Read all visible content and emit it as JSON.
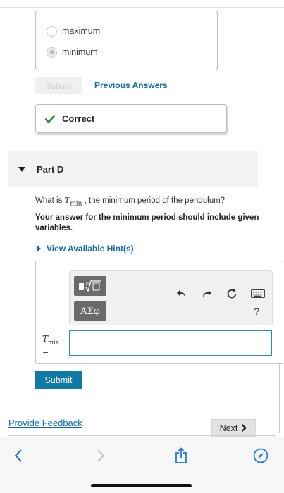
{
  "options": [
    {
      "label": "maximum",
      "selected": false
    },
    {
      "label": "minimum",
      "selected": true
    }
  ],
  "prev_part": {
    "submit_label": "Submit",
    "previous_answers_label": "Previous Answers",
    "feedback_label": "Correct"
  },
  "part": {
    "title": "Part D",
    "question_prefix": "What is ",
    "question_var": "T",
    "question_var_sub": "min",
    "question_suffix": " , the minimum period of the pendulum?",
    "instruction": "Your answer for the minimum period should include given variables.",
    "hints_label": "View Available Hint(s)"
  },
  "answer": {
    "greek_label": "ΑΣφ",
    "help_label": "?",
    "var_label": "T",
    "var_sub": "min",
    "equals": "=",
    "value": "",
    "submit_label": "Submit"
  },
  "footer": {
    "feedback_link": "Provide Feedback",
    "next_label": "Next"
  },
  "colors": {
    "link": "#0b6db1",
    "submit": "#0e7aa5",
    "correct_check": "#2e8b2e",
    "input_focus": "#1f8fd6",
    "browser_tint": "#1a73e8"
  }
}
